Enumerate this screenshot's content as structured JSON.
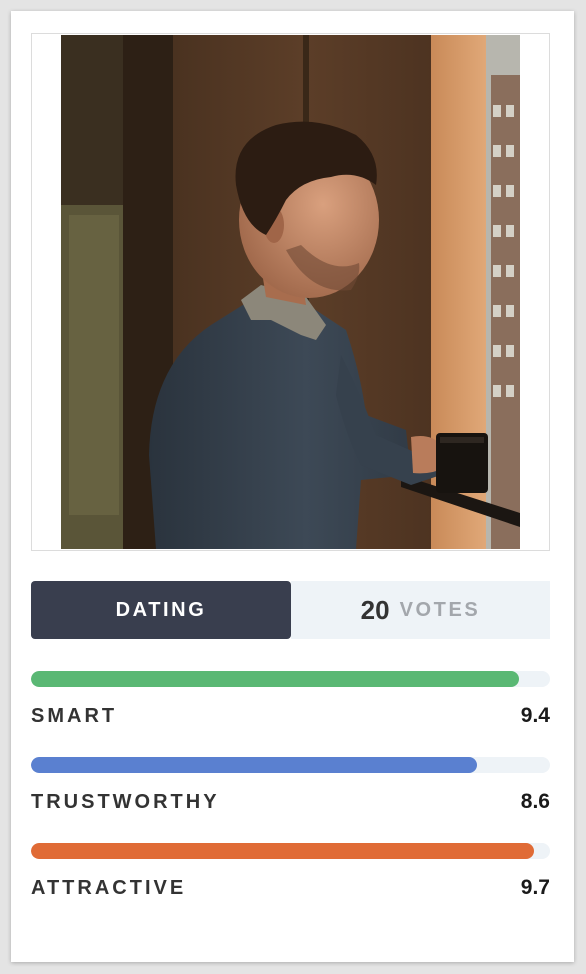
{
  "profile": {
    "photo_alt": "photo",
    "category_label": "DATING",
    "votes_count": "20",
    "votes_label": "VOTES"
  },
  "traits": [
    {
      "name": "SMART",
      "score": "9.4",
      "fraction": 0.94,
      "color": "#5ab874"
    },
    {
      "name": "TRUSTWORTHY",
      "score": "8.6",
      "fraction": 0.86,
      "color": "#5a80d0"
    },
    {
      "name": "ATTRACTIVE",
      "score": "9.7",
      "fraction": 0.97,
      "color": "#e06b36"
    }
  ]
}
